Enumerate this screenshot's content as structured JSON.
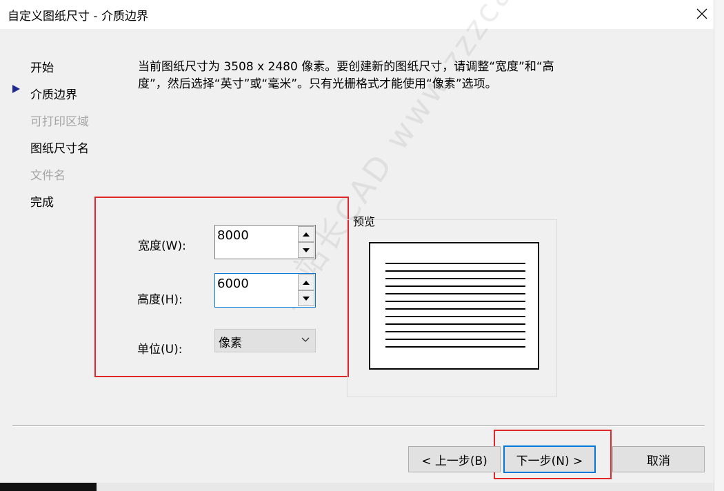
{
  "window": {
    "title": "自定义图纸尺寸 - 介质边界",
    "close_icon": "close-icon"
  },
  "steps": [
    {
      "label": "开始",
      "state": "normal"
    },
    {
      "label": "介质边界",
      "state": "current"
    },
    {
      "label": "可打印区域",
      "state": "disabled"
    },
    {
      "label": "图纸尺寸名",
      "state": "normal"
    },
    {
      "label": "文件名",
      "state": "disabled"
    },
    {
      "label": "完成",
      "state": "normal"
    }
  ],
  "description": "当前图纸尺寸为 3508 x 2480 像素。要创建新的图纸尺寸，请调整“宽度”和“高度”，然后选择“英寸”或“毫米”。只有光栅格式才能使用“像素”选项。",
  "form": {
    "width_label": "宽度(W):",
    "width_value": "8000",
    "height_label": "高度(H):",
    "height_value": "6000",
    "unit_label": "单位(U):",
    "unit_value": "像素"
  },
  "preview": {
    "label": "预览"
  },
  "buttons": {
    "back": "< 上一步(B)",
    "next": "下一步(N) >",
    "cancel": "取消"
  },
  "watermark": "周站长CAD  www.zzzcad.com",
  "colors": {
    "highlight": "#e0262a",
    "accent": "#0078d7",
    "step_arrow": "#1f2a8c"
  }
}
